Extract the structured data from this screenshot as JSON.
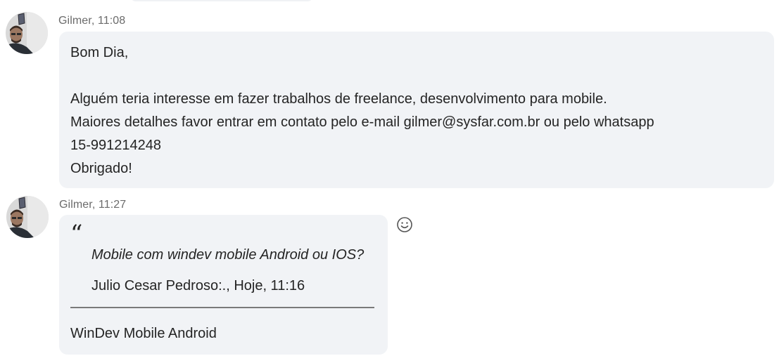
{
  "messages": [
    {
      "author": "Gilmer",
      "meta": "Gilmer, 11:08",
      "lines": [
        "Bom Dia,",
        "",
        "Alguém teria interesse em fazer trabalhos de freelance, desenvolvimento para mobile.",
        "Maiores detalhes favor entrar em contato pelo e-mail gilmer@sysfar.com.br ou pelo whatsapp",
        "15-991214248",
        "Obrigado!"
      ]
    },
    {
      "author": "Gilmer",
      "meta": "Gilmer, 11:27",
      "quote": {
        "mark": "“",
        "text": "Mobile com windev mobile Android ou IOS?",
        "source": "Julio Cesar Pedroso:., Hoje, 11:16"
      },
      "reply": "WinDev Mobile Android"
    }
  ],
  "icons": {
    "avatar": "avatar-photo",
    "reaction": "smiley-face-icon"
  },
  "colors": {
    "bubble": "#f1f3f6",
    "meta_text": "#6b6b6b",
    "body_text": "#242424"
  }
}
